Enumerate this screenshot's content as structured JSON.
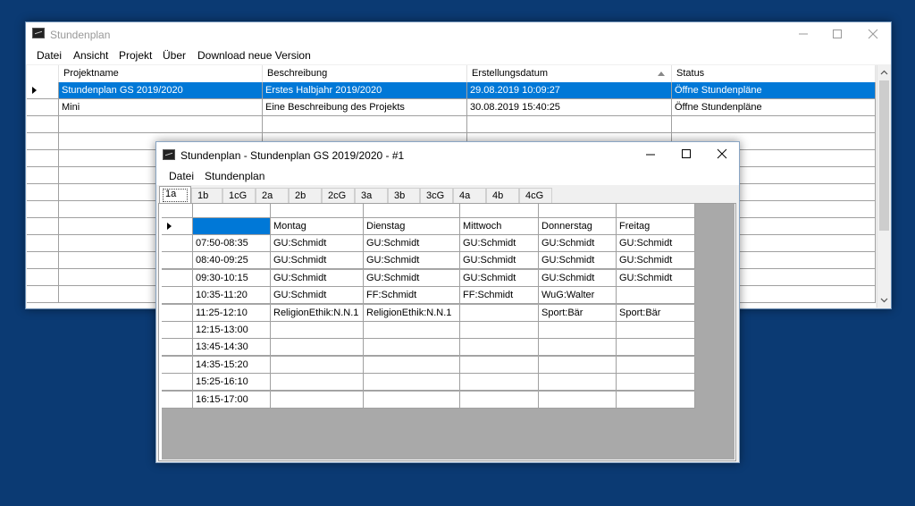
{
  "main_window": {
    "title": "Stundenplan",
    "menu": [
      "Datei",
      "Ansicht",
      "Projekt",
      "Über",
      "Download neue Version"
    ],
    "columns": [
      "Projektname",
      "Beschreibung",
      "Erstellungsdatum",
      "Status"
    ],
    "rows": [
      [
        "Stundenplan GS 2019/2020",
        "Erstes Halbjahr 2019/2020",
        "29.08.2019 10:09:27",
        "Öffne Stundenpläne"
      ],
      [
        "Mini",
        "Eine Beschreibung des Projekts",
        "30.08.2019 15:40:25",
        "Öffne Stundenpläne"
      ]
    ],
    "empty_rows": 11,
    "selected_row": 0,
    "sort_column": 2
  },
  "child_window": {
    "title": "Stundenplan - Stundenplan GS 2019/2020 - #1",
    "menu": [
      "Datei",
      "Stundenplan"
    ],
    "tabs": [
      "1a",
      "1b",
      "1cG",
      "2a",
      "2b",
      "2cG",
      "3a",
      "3b",
      "3cG",
      "4a",
      "4b",
      "4cG"
    ],
    "active_tab": 0,
    "days": [
      "Montag",
      "Dienstag",
      "Mittwoch",
      "Donnerstag",
      "Freitag"
    ],
    "timetable": [
      {
        "time": "07:50-08:35",
        "cells": [
          "GU:Schmidt",
          "GU:Schmidt",
          "GU:Schmidt",
          "GU:Schmidt",
          "GU:Schmidt"
        ]
      },
      {
        "time": "08:40-09:25",
        "cells": [
          "GU:Schmidt",
          "GU:Schmidt",
          "GU:Schmidt",
          "GU:Schmidt",
          "GU:Schmidt"
        ]
      },
      {
        "time": "09:30-10:15",
        "cells": [
          "GU:Schmidt",
          "GU:Schmidt",
          "GU:Schmidt",
          "GU:Schmidt",
          "GU:Schmidt"
        ]
      },
      {
        "time": "10:35-11:20",
        "cells": [
          "GU:Schmidt",
          "FF:Schmidt",
          "FF:Schmidt",
          "WuG:Walter",
          ""
        ]
      },
      {
        "time": "11:25-12:10",
        "cells": [
          "ReligionEthik:N.N.1",
          "ReligionEthik:N.N.1",
          "",
          "Sport:Bär",
          "Sport:Bär"
        ]
      },
      {
        "time": "12:15-13:00",
        "cells": [
          "",
          "",
          "",
          "",
          ""
        ]
      },
      {
        "time": "13:45-14:30",
        "cells": [
          "",
          "",
          "",
          "",
          ""
        ]
      },
      {
        "time": "14:35-15:20",
        "cells": [
          "",
          "",
          "",
          "",
          ""
        ]
      },
      {
        "time": "15:25-16:10",
        "cells": [
          "",
          "",
          "",
          "",
          ""
        ]
      },
      {
        "time": "16:15-17:00",
        "cells": [
          "",
          "",
          "",
          "",
          ""
        ]
      }
    ]
  },
  "icons": {
    "app": "app-icon",
    "minimize": "minimize-icon",
    "maximize": "maximize-icon",
    "close": "close-icon",
    "scroll_up": "chevron-up-icon",
    "scroll_down": "chevron-down-icon",
    "sort": "sort-ascending-icon",
    "row_pointer": "row-pointer-icon"
  },
  "colors": {
    "desktop": "#0b3a73",
    "selection": "#0078d7",
    "grid_background": "#a9a9a9"
  }
}
